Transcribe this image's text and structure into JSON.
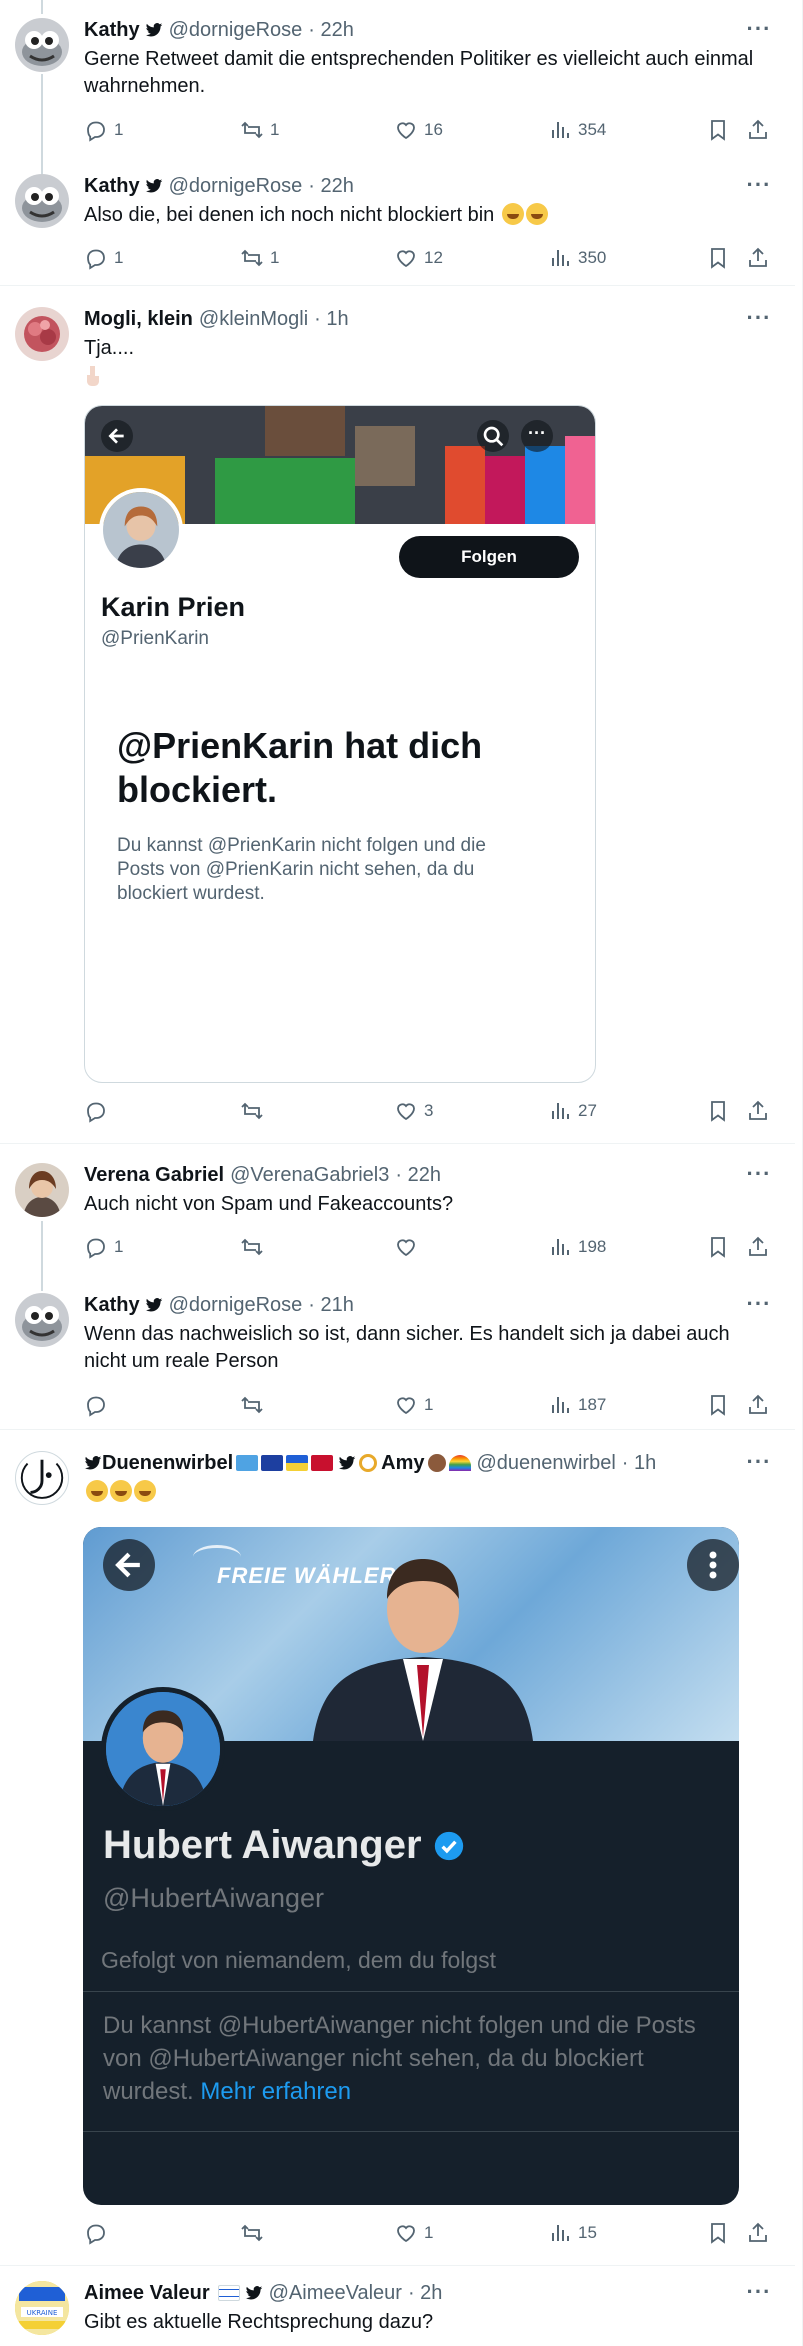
{
  "posts": [
    {
      "name": "Kathy",
      "handle": "@dornigeRose",
      "time": "· 22h",
      "text": "Gerne Retweet damit die entsprechenden Politiker es vielleicht auch einmal wahrnehmen.",
      "replies": "1",
      "reposts": "1",
      "likes": "16",
      "views": "354"
    },
    {
      "name": "Kathy",
      "handle": "@dornigeRose",
      "time": "· 22h",
      "text": "Also die, bei denen ich noch nicht blockiert bin",
      "replies": "1",
      "reposts": "1",
      "likes": "12",
      "views": "350"
    },
    {
      "name": "Mogli, klein",
      "handle": "@kleinMogli",
      "time": "· 1h",
      "text": "Tja....",
      "replies": "",
      "reposts": "",
      "likes": "3",
      "views": "27",
      "card": {
        "follow_label": "Folgen",
        "profile_name": "Karin Prien",
        "profile_handle": "@PrienKarin",
        "blocked_title": "@PrienKarin hat dich blockiert.",
        "blocked_body": "Du kannst @PrienKarin nicht folgen und die Posts von @PrienKarin nicht sehen, da du blockiert wurdest."
      }
    },
    {
      "name": "Verena Gabriel",
      "handle": "@VerenaGabriel3",
      "time": "· 22h",
      "text": "Auch nicht von Spam und Fakeaccounts?",
      "replies": "1",
      "reposts": "",
      "likes": "",
      "views": "198"
    },
    {
      "name": "Kathy",
      "handle": "@dornigeRose",
      "time": "· 21h",
      "text": "Wenn das nachweislich so ist, dann sicher. Es handelt sich ja dabei auch nicht um reale Person",
      "replies": "",
      "reposts": "",
      "likes": "1",
      "views": "187"
    },
    {
      "name": "Duenenwirbel",
      "name_suffix": "Amy",
      "handle": "@duenenwirbel",
      "time": "· 1h",
      "text": "",
      "replies": "",
      "reposts": "",
      "likes": "1",
      "views": "15",
      "card": {
        "banner_text": "FREIE WÄHLER",
        "profile_name": "Hubert Aiwanger",
        "profile_handle": "@HubertAiwanger",
        "followed_by": "Gefolgt von niemandem, dem du folgst",
        "blocked_body": "Du kannst @HubertAiwanger nicht folgen und die Posts von @HubertAiwanger nicht sehen, da du blockiert wurdest.",
        "learn_more": "Mehr erfahren"
      }
    },
    {
      "name": "Aimee Valeur",
      "handle": "@AimeeValeur",
      "time": "· 2h",
      "text": "Gibt es aktuelle Rechtsprechung dazu?"
    }
  ],
  "colors": {
    "text": "#0f1419",
    "secondary": "#536471",
    "link": "#1d9bf0",
    "border": "#eff3f4",
    "dark_card": "#15202b"
  },
  "icons": [
    "reply-icon",
    "repost-icon",
    "like-icon",
    "views-icon",
    "bookmark-icon",
    "share-icon",
    "more-icon",
    "verified-icon",
    "back-icon",
    "search-icon"
  ]
}
